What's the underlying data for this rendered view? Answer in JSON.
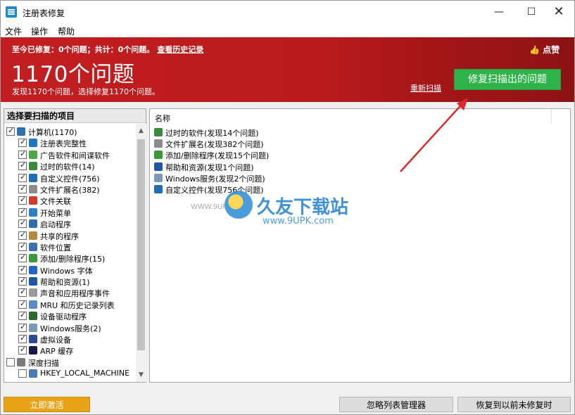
{
  "window": {
    "title": "注册表修复",
    "controls": {
      "minimize": "—",
      "maximize": "☐",
      "close": "✕"
    }
  },
  "menu": [
    "文件",
    "操作",
    "帮助"
  ],
  "banner": {
    "summary": "至今已修复：0个问题；共计：0个问题。",
    "history_link": "查看历史记录",
    "issue_count": "1170个问题",
    "subline": "发现1170个问题，选择修复1170个问题。",
    "like": "点赞",
    "rescan": "重新扫描",
    "fix_button": "修复扫描出的问题"
  },
  "left_panel": {
    "header": "选择要扫描的项目",
    "scroll_up": "▲",
    "scroll_down": "▼",
    "items": [
      {
        "label": "计算机(1170)",
        "level": 0,
        "checked": true,
        "icon": "computer-icon",
        "color": "#2c6fb3"
      },
      {
        "label": "注册表完整性",
        "level": 1,
        "checked": true,
        "icon": "registry-icon",
        "color": "#1e78c8"
      },
      {
        "label": "广告软件和间谍软件",
        "level": 1,
        "checked": true,
        "icon": "shield-icon",
        "color": "#4aa84a"
      },
      {
        "label": "过时的软件(14)",
        "level": 1,
        "checked": true,
        "icon": "trash-icon",
        "color": "#3b8a3b"
      },
      {
        "label": "自定义控件(756)",
        "level": 1,
        "checked": true,
        "icon": "control-icon",
        "color": "#1f6fb8"
      },
      {
        "label": "文件扩展名(382)",
        "level": 1,
        "checked": true,
        "icon": "file-icon",
        "color": "#8c8c8c"
      },
      {
        "label": "文件关联",
        "level": 1,
        "checked": true,
        "icon": "file-assoc-icon",
        "color": "#d23a2a"
      },
      {
        "label": "开始菜单",
        "level": 1,
        "checked": true,
        "icon": "start-menu-icon",
        "color": "#2d7fc8"
      },
      {
        "label": "启动程序",
        "level": 1,
        "checked": true,
        "icon": "startup-icon",
        "color": "#2f6fb0"
      },
      {
        "label": "共享的程序",
        "level": 1,
        "checked": true,
        "icon": "share-icon",
        "color": "#b58a3a"
      },
      {
        "label": "软件位置",
        "level": 1,
        "checked": true,
        "icon": "folder-icon",
        "color": "#3a6fb0"
      },
      {
        "label": "添加/删除程序(15)",
        "level": 1,
        "checked": true,
        "icon": "recycle-icon",
        "color": "#3a9a3a"
      },
      {
        "label": "Windows 字体",
        "level": 1,
        "checked": true,
        "icon": "font-icon",
        "color": "#1e66c8"
      },
      {
        "label": "帮助和资源(1)",
        "level": 1,
        "checked": true,
        "icon": "help-icon",
        "color": "#1e56a8"
      },
      {
        "label": "声音和应用程序事件",
        "level": 1,
        "checked": true,
        "icon": "sound-icon",
        "color": "#9a9a9a"
      },
      {
        "label": "MRU 和历史记录列表",
        "level": 1,
        "checked": true,
        "icon": "history-icon",
        "color": "#5a8ac8"
      },
      {
        "label": "设备驱动程序",
        "level": 1,
        "checked": true,
        "icon": "driver-icon",
        "color": "#2a6a2a"
      },
      {
        "label": "Windows服务(2)",
        "level": 1,
        "checked": true,
        "icon": "service-icon",
        "color": "#7a9ab8"
      },
      {
        "label": "虚拟设备",
        "level": 1,
        "checked": true,
        "icon": "virtual-device-icon",
        "color": "#2a4a9a"
      },
      {
        "label": "ARP 缓存",
        "level": 1,
        "checked": true,
        "icon": "network-icon",
        "color": "#1a1a4a"
      },
      {
        "label": "深度扫描",
        "level": 0,
        "checked": false,
        "icon": "magnifier-icon",
        "color": "#7a7a7a"
      },
      {
        "label": "HKEY_LOCAL_MACHINE",
        "level": 1,
        "checked": false,
        "icon": "registry-key-icon",
        "color": "#4a7ab8"
      }
    ]
  },
  "right_panel": {
    "column_name": "名称",
    "results": [
      {
        "label": "过时的软件(发现14个问题)",
        "icon": "trash-icon",
        "color": "#3b8a3b"
      },
      {
        "label": "文件扩展名(发现382个问题)",
        "icon": "file-icon",
        "color": "#8c8c8c"
      },
      {
        "label": "添加/删除程序(发现15个问题)",
        "icon": "recycle-icon",
        "color": "#3a9a3a"
      },
      {
        "label": "帮助和资源(发现1个问题)",
        "icon": "help-icon",
        "color": "#1e56a8"
      },
      {
        "label": "Windows服务(发现2个问题)",
        "icon": "service-icon",
        "color": "#7a9ab8"
      },
      {
        "label": "自定义控件(发现756个问题)",
        "icon": "control-icon",
        "color": "#1f6fb8"
      }
    ]
  },
  "watermark": {
    "title": "久友下载站",
    "url": "www.9UPK.com",
    "url_left": "WWW.9UPK.COM"
  },
  "buttons": {
    "activate": "立即激活",
    "ignore_list": "忽略列表管理器",
    "restore": "恢复到以前未修复时"
  },
  "colors": {
    "banner_red": "#c21f22",
    "fix_green": "#2fb44a",
    "activate_orange": "#e8a317",
    "annotation_arrow": "#d92b2b"
  }
}
